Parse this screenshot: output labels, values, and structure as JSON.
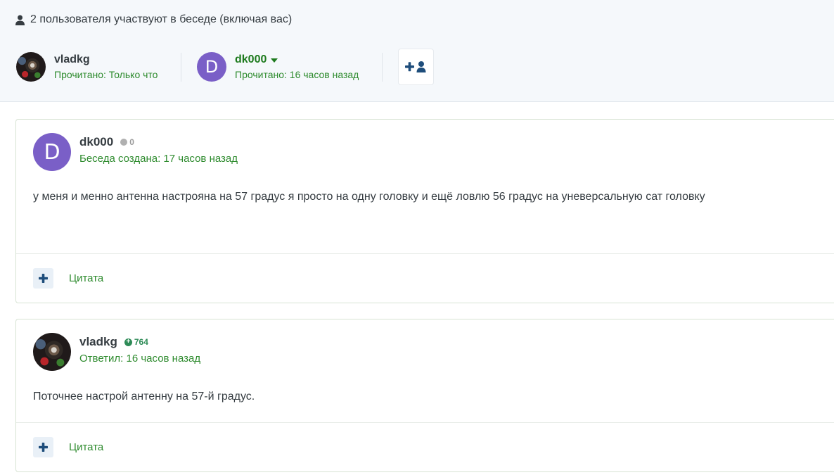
{
  "participants": {
    "title": "2 пользователя участвуют в беседе (включая вас)",
    "users": [
      {
        "name": "vladkg",
        "read": "Прочитано: Только что",
        "avatar": "photo"
      },
      {
        "name": "dk000",
        "read": "Прочитано: 16 часов назад",
        "avatar_letter": "D"
      }
    ],
    "add_user_icon": "add-user-icon"
  },
  "messages": [
    {
      "author": "dk000",
      "avatar_letter": "D",
      "reputation": "0",
      "meta": "Беседа создана: 17 часов назад",
      "body": "у меня и менно антенна настрояна на 57 градус я просто на одну головку и ещё ловлю 56 градус на уневерсальную сат головку",
      "quote_label": "Цитата"
    },
    {
      "author": "vladkg",
      "avatar": "photo",
      "reputation": "764",
      "meta": "Ответил: 16 часов назад",
      "body": "Поточнее настрой антенну на 57-й градус.",
      "quote_label": "Цитата"
    }
  ],
  "colors": {
    "accent_green": "#2e8b2e",
    "avatar_purple": "#7a5fc7",
    "header_bg": "#f5f8fb",
    "icon_navy": "#1e4d7b"
  }
}
